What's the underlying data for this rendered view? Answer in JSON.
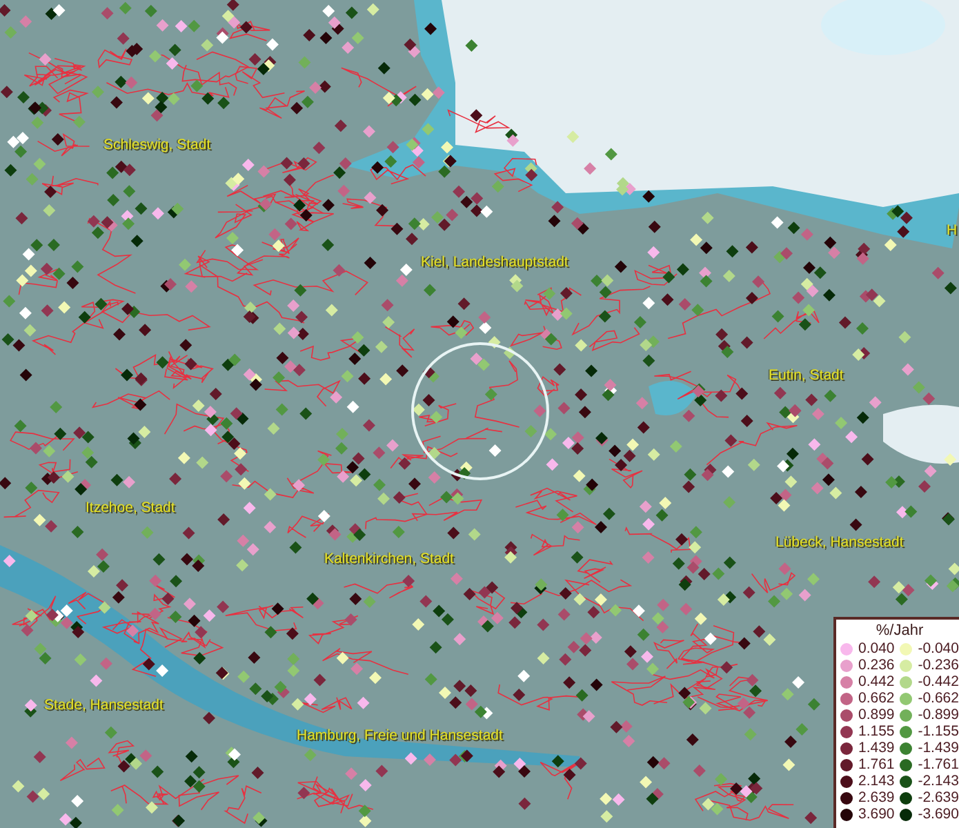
{
  "map": {
    "place_labels": [
      {
        "text": "Schleswig, Stadt"
      },
      {
        "text": "Kiel, Landeshauptstadt"
      },
      {
        "text": "H"
      },
      {
        "text": "Eutin, Stadt"
      },
      {
        "text": "Itzehoe, Stadt"
      },
      {
        "text": "Lübeck, Hansestadt"
      },
      {
        "text": "Kaltenkirchen, Stadt"
      },
      {
        "text": "Stade, Hansestadt"
      },
      {
        "text": "Hamburg, Freie und Hansestadt"
      }
    ]
  },
  "legend": {
    "title": "%/Jahr",
    "positive": [
      {
        "value": "0.040",
        "color": "#f8b8ec"
      },
      {
        "value": "0.236",
        "color": "#e8a0cc"
      },
      {
        "value": "0.442",
        "color": "#d680a6"
      },
      {
        "value": "0.662",
        "color": "#c26486"
      },
      {
        "value": "0.899",
        "color": "#aa4c6a"
      },
      {
        "value": "1.155",
        "color": "#923652"
      },
      {
        "value": "1.439",
        "color": "#7a263c"
      },
      {
        "value": "1.761",
        "color": "#621a2a"
      },
      {
        "value": "2.143",
        "color": "#4c0e1a"
      },
      {
        "value": "2.639",
        "color": "#380810"
      },
      {
        "value": "3.690",
        "color": "#240408"
      }
    ],
    "negative": [
      {
        "value": "-0.040",
        "color": "#f2f8b4"
      },
      {
        "value": "-0.236",
        "color": "#d6eca2"
      },
      {
        "value": "-0.442",
        "color": "#b2d88a"
      },
      {
        "value": "-0.662",
        "color": "#92c872"
      },
      {
        "value": "-0.899",
        "color": "#72b05a"
      },
      {
        "value": "-1.155",
        "color": "#529842"
      },
      {
        "value": "-1.439",
        "color": "#3c8232"
      },
      {
        "value": "-1.761",
        "color": "#2a6a22"
      },
      {
        "value": "-2.143",
        "color": "#1a5218"
      },
      {
        "value": "-2.639",
        "color": "#0e3e0e"
      },
      {
        "value": "-3.690",
        "color": "#062a08"
      }
    ]
  }
}
